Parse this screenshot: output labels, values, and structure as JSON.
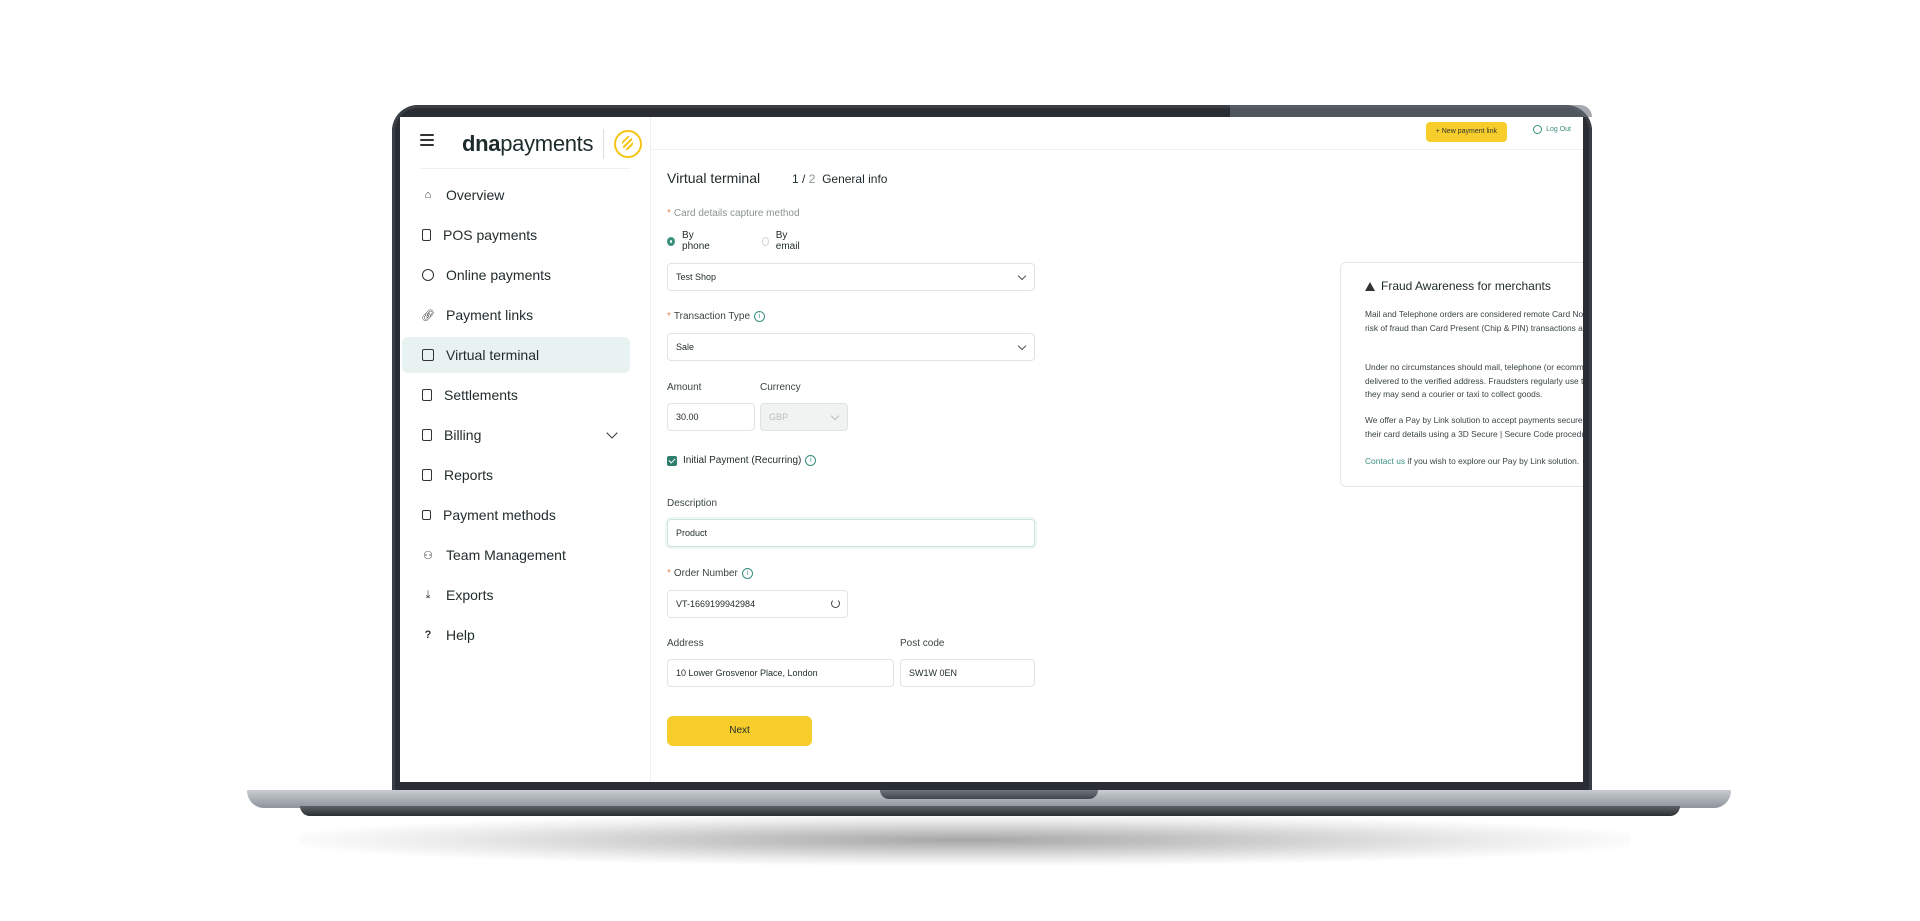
{
  "brand": {
    "name_bold": "dna",
    "name_rest": "payments"
  },
  "header": {
    "new_payment_link": "+ New payment link",
    "logout": "Log Out"
  },
  "sidebar": {
    "items": [
      {
        "label": "Overview",
        "icon": "home-icon"
      },
      {
        "label": "POS payments",
        "icon": "pos-terminal-icon"
      },
      {
        "label": "Online payments",
        "icon": "globe-icon"
      },
      {
        "label": "Payment links",
        "icon": "link-icon"
      },
      {
        "label": "Virtual terminal",
        "icon": "terminal-icon",
        "active": true
      },
      {
        "label": "Settlements",
        "icon": "document-icon"
      },
      {
        "label": "Billing",
        "icon": "billing-icon",
        "expandable": true
      },
      {
        "label": "Reports",
        "icon": "report-icon"
      },
      {
        "label": "Payment methods",
        "icon": "card-stack-icon"
      },
      {
        "label": "Team Management",
        "icon": "team-icon"
      },
      {
        "label": "Exports",
        "icon": "download-icon"
      },
      {
        "label": "Help",
        "icon": "help-icon"
      }
    ]
  },
  "page": {
    "title": "Virtual terminal",
    "step_current": "1",
    "step_sep": "/",
    "step_total": "2",
    "step_name": "General info"
  },
  "form": {
    "capture_method_label": "Card details capture method",
    "capture_options": [
      "By phone",
      "By email"
    ],
    "capture_selected": "By phone",
    "shop_value": "Test Shop",
    "transaction_type_label": "Transaction Type",
    "transaction_type_value": "Sale",
    "amount_label": "Amount",
    "amount_value": "30.00",
    "currency_label": "Currency",
    "currency_value": "GBP",
    "initial_payment_label": "Initial Payment (Recurring)",
    "initial_payment_checked": true,
    "description_label": "Description",
    "description_value": "Product",
    "order_number_label": "Order Number",
    "order_number_value": "VT-1669199942984",
    "address_label": "Address",
    "address_value": "10 Lower Grosvenor Place, London",
    "postcode_label": "Post code",
    "postcode_value": "SW1W 0EN",
    "next_label": "Next"
  },
  "fraud": {
    "title": "Fraud Awareness for merchants",
    "p1": "Mail and Telephone orders are considered remote Card Not Present (CNP) transactions. They involve a much higher risk of fraud than Card Present (Chip & PIN) transactions and online payments completed using 3DSecure.",
    "p2": "Under no circumstances should mail, telephone (or ecommerce orders) be collected from the store; they should be delivered to the verified address. Fraudsters regularly use this method to undermine the security measures in place; they may send a courier or taxi to collect goods.",
    "p3": "We offer a Pay by Link solution to accept payments securely, even without a website. Using Pay by Link, buyers enter their card details using a 3D Secure | Secure Code procedure.",
    "contact_link": "Contact us",
    "p4_rest": "if you wish to explore our Pay by Link solution."
  },
  "colors": {
    "accent_yellow": "#f6cd2a",
    "accent_green": "#2f7e6d",
    "active_bg": "#e8f2f0",
    "laptop_frame": "#2a2e34"
  }
}
